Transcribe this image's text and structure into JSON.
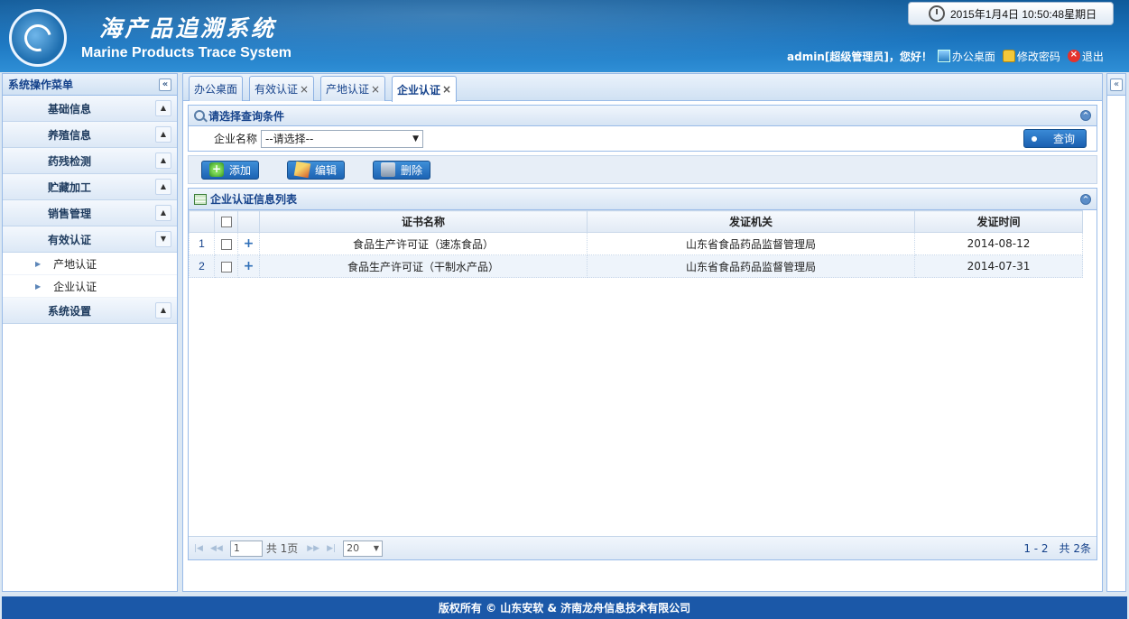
{
  "header": {
    "title_cn": "海产品追溯系统",
    "title_en": "Marine Products Trace System",
    "datetime": "2015年1月4日  10:50:48星期日",
    "user_greeting": "admin[超级管理员]，您好！",
    "links": [
      {
        "label": "办公桌面",
        "icon": "desktop-icon"
      },
      {
        "label": "修改密码",
        "icon": "lock-icon"
      },
      {
        "label": "退出",
        "icon": "exit-icon"
      }
    ]
  },
  "sidebar": {
    "title": "系统操作菜单",
    "groups": [
      {
        "label": "基础信息"
      },
      {
        "label": "养殖信息"
      },
      {
        "label": "药残检测"
      },
      {
        "label": "贮藏加工"
      },
      {
        "label": "销售管理"
      },
      {
        "label": "有效认证",
        "items": [
          "产地认证",
          "企业认证"
        ]
      },
      {
        "label": "系统设置"
      }
    ]
  },
  "tabs": [
    {
      "label": "办公桌面",
      "closable": false
    },
    {
      "label": "有效认证",
      "closable": true
    },
    {
      "label": "产地认证",
      "closable": true
    },
    {
      "label": "企业认证",
      "closable": true,
      "active": true
    }
  ],
  "query": {
    "title": "请选择查询条件",
    "field_label": "企业名称",
    "select_value": "--请选择--",
    "search_button": "查询"
  },
  "toolbar": {
    "add": "添加",
    "edit": "编辑",
    "delete": "删除"
  },
  "grid": {
    "title": "企业认证信息列表",
    "columns": [
      "证书名称",
      "发证机关",
      "发证时间"
    ],
    "rows": [
      {
        "index": "1",
        "name": "食品生产许可证（速冻食品）",
        "authority": "山东省食品药品监督管理局",
        "date": "2014-08-12"
      },
      {
        "index": "2",
        "name": "食品生产许可证（干制水产品）",
        "authority": "山东省食品药品监督管理局",
        "date": "2014-07-31"
      }
    ]
  },
  "pager": {
    "page_input": "1",
    "total_pages_label": "共  1页",
    "page_size": "20",
    "info": "1 - 2　共 2条"
  },
  "footer": {
    "text": "版权所有 © 山东安软 & 济南龙舟信息技术有限公司"
  }
}
